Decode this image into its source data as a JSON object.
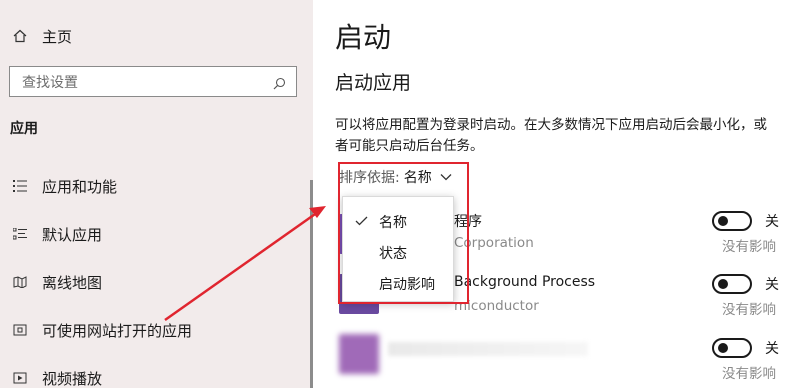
{
  "sidebar": {
    "home_label": "主页",
    "search_placeholder": "查找设置",
    "section_title": "应用",
    "items": [
      {
        "label": "应用和功能",
        "icon": "apps-features-icon"
      },
      {
        "label": "默认应用",
        "icon": "default-apps-icon"
      },
      {
        "label": "离线地图",
        "icon": "offline-maps-icon"
      },
      {
        "label": "可使用网站打开的应用",
        "icon": "apps-for-websites-icon"
      },
      {
        "label": "视频播放",
        "icon": "video-playback-icon"
      }
    ]
  },
  "main": {
    "title": "启动",
    "subtitle": "启动应用",
    "description": "可以将应用配置为登录时启动。在大多数情况下应用启动后会最小化，或者可能只启动后台任务。",
    "sort": {
      "label": "排序依据:",
      "value": "名称"
    },
    "dropdown": {
      "options": [
        {
          "label": "名称",
          "checked": true
        },
        {
          "label": "状态",
          "checked": false
        },
        {
          "label": "启动影响",
          "checked": false
        }
      ]
    },
    "apps": [
      {
        "name": "程序",
        "publisher": "Corporation",
        "toggle_state": "关",
        "impact": "没有影响",
        "icon_color": "#7a4fb5"
      },
      {
        "name": "Background Process",
        "publisher": "miconductor",
        "toggle_state": "关",
        "impact": "没有影响",
        "icon_color": "#6a4aa0"
      },
      {
        "name": "",
        "publisher": "",
        "toggle_state": "关",
        "impact": "没有影响",
        "icon_color": "#a06ab8"
      }
    ]
  },
  "colors": {
    "sidebar_bg": "#f2ebeb",
    "highlight_red": "#e0252f",
    "muted_text": "#8a8a8a"
  }
}
